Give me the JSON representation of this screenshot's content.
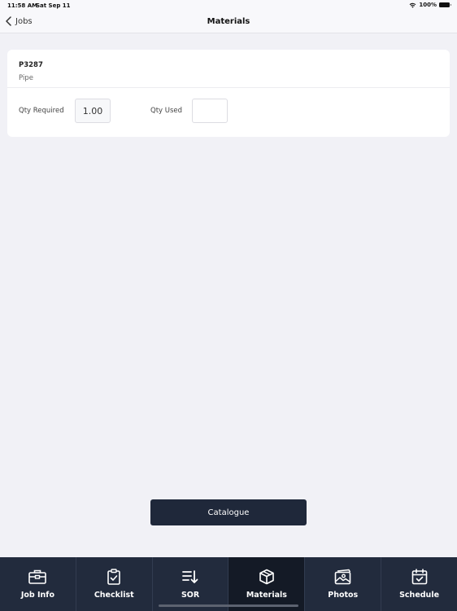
{
  "status_bar": {
    "time": "11:58 AM",
    "date": "Sat Sep 11",
    "battery": "100%"
  },
  "nav": {
    "back_label": "Jobs",
    "title": "Materials"
  },
  "material": {
    "code": "P3287",
    "description": "Pipe",
    "qty_required_label": "Qty Required",
    "qty_required_value": "1.00",
    "qty_used_label": "Qty Used",
    "qty_used_value": ""
  },
  "catalogue_button": "Catalogue",
  "tabs": [
    {
      "label": "Job Info",
      "icon": "briefcase-icon"
    },
    {
      "label": "Checklist",
      "icon": "clipboard-check-icon"
    },
    {
      "label": "SOR",
      "icon": "sort-down-icon"
    },
    {
      "label": "Materials",
      "icon": "box-icon",
      "active": true
    },
    {
      "label": "Photos",
      "icon": "photos-icon"
    },
    {
      "label": "Schedule",
      "icon": "calendar-check-icon"
    }
  ],
  "colors": {
    "tabbar": "#222b3d",
    "tab_active": "#141a26",
    "button": "#1f283a",
    "background": "#f1f1f6"
  }
}
